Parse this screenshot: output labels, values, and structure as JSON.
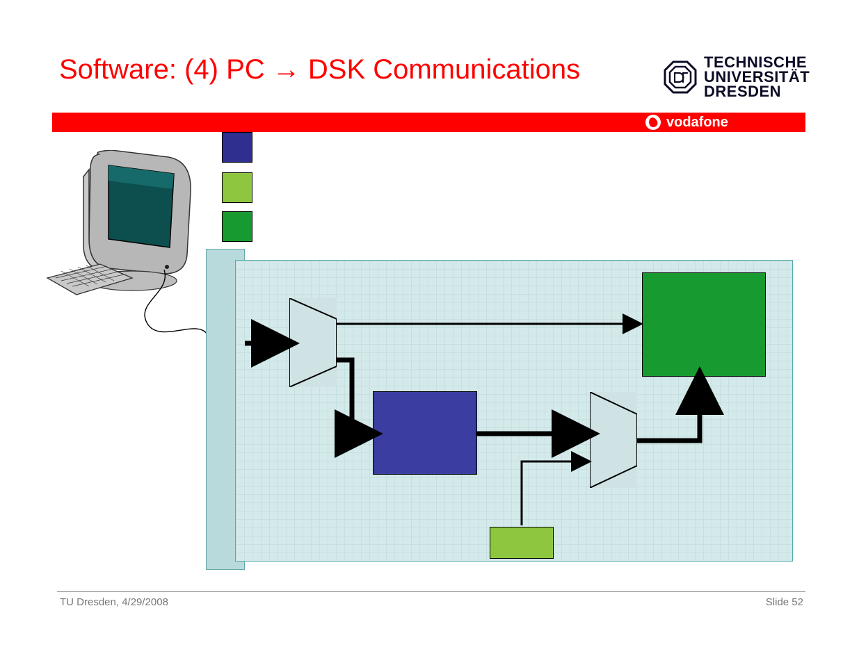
{
  "title": "Software: (4) PC → DSK Communications",
  "logo": {
    "line1": "TECHNISCHE",
    "line2": "UNIVERSITÄT",
    "line3": "DRESDEN"
  },
  "banner": {
    "vodafone": "vodafone"
  },
  "legend": {
    "blue": "blue-block",
    "lime": "lime-block",
    "green": "green-block"
  },
  "footer": {
    "left": "TU Dresden, 4/29/2008",
    "right": "Slide 52"
  },
  "colors": {
    "accent": "#ff0000",
    "board": "#d4e9ea",
    "blue_box": "#3b3ea0",
    "green_box": "#179a2f",
    "lime_box": "#8ec73f"
  }
}
